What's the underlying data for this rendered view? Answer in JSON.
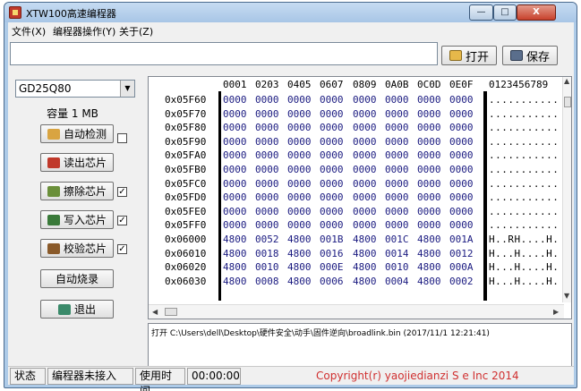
{
  "window": {
    "title": "XTW100高速编程器",
    "min_glyph": "—",
    "max_glyph": "□",
    "close_glyph": "X"
  },
  "menu": {
    "file": "文件(X)",
    "operate": "编程器操作(Y)",
    "about": "关于(Z)"
  },
  "toolbar": {
    "open_label": "打开",
    "save_label": "保存"
  },
  "left": {
    "chip": "GD25Q80",
    "capacity": "容量 1 MB",
    "auto_detect": "自动检测",
    "read_chip": "读出芯片",
    "erase_chip": "擦除芯片",
    "write_chip": "写入芯片",
    "verify_chip": "校验芯片",
    "auto_burn": "自动烧录",
    "exit": "退出",
    "check_mark": "✓"
  },
  "hex": {
    "columns": [
      "0001",
      "0203",
      "0405",
      "0607",
      "0809",
      "0A0B",
      "0C0D",
      "0E0F"
    ],
    "ascii_header": "0123456789",
    "rows": [
      {
        "addr": "0x05F60",
        "cells": [
          "0000",
          "0000",
          "0000",
          "0000",
          "0000",
          "0000",
          "0000",
          "0000"
        ],
        "ascii": "..........."
      },
      {
        "addr": "0x05F70",
        "cells": [
          "0000",
          "0000",
          "0000",
          "0000",
          "0000",
          "0000",
          "0000",
          "0000"
        ],
        "ascii": "..........."
      },
      {
        "addr": "0x05F80",
        "cells": [
          "0000",
          "0000",
          "0000",
          "0000",
          "0000",
          "0000",
          "0000",
          "0000"
        ],
        "ascii": "..........."
      },
      {
        "addr": "0x05F90",
        "cells": [
          "0000",
          "0000",
          "0000",
          "0000",
          "0000",
          "0000",
          "0000",
          "0000"
        ],
        "ascii": "..........."
      },
      {
        "addr": "0x05FA0",
        "cells": [
          "0000",
          "0000",
          "0000",
          "0000",
          "0000",
          "0000",
          "0000",
          "0000"
        ],
        "ascii": "..........."
      },
      {
        "addr": "0x05FB0",
        "cells": [
          "0000",
          "0000",
          "0000",
          "0000",
          "0000",
          "0000",
          "0000",
          "0000"
        ],
        "ascii": "..........."
      },
      {
        "addr": "0x05FC0",
        "cells": [
          "0000",
          "0000",
          "0000",
          "0000",
          "0000",
          "0000",
          "0000",
          "0000"
        ],
        "ascii": "..........."
      },
      {
        "addr": "0x05FD0",
        "cells": [
          "0000",
          "0000",
          "0000",
          "0000",
          "0000",
          "0000",
          "0000",
          "0000"
        ],
        "ascii": "..........."
      },
      {
        "addr": "0x05FE0",
        "cells": [
          "0000",
          "0000",
          "0000",
          "0000",
          "0000",
          "0000",
          "0000",
          "0000"
        ],
        "ascii": "..........."
      },
      {
        "addr": "0x05FF0",
        "cells": [
          "0000",
          "0000",
          "0000",
          "0000",
          "0000",
          "0000",
          "0000",
          "0000"
        ],
        "ascii": "..........."
      },
      {
        "addr": "0x06000",
        "cells": [
          "4800",
          "0052",
          "4800",
          "001B",
          "4800",
          "001C",
          "4800",
          "001A"
        ],
        "ascii": "H..RH....H."
      },
      {
        "addr": "0x06010",
        "cells": [
          "4800",
          "0018",
          "4800",
          "0016",
          "4800",
          "0014",
          "4800",
          "0012"
        ],
        "ascii": "H...H....H."
      },
      {
        "addr": "0x06020",
        "cells": [
          "4800",
          "0010",
          "4800",
          "000E",
          "4800",
          "0010",
          "4800",
          "000A"
        ],
        "ascii": "H...H....H."
      },
      {
        "addr": "0x06030",
        "cells": [
          "4800",
          "0008",
          "4800",
          "0006",
          "4800",
          "0004",
          "4800",
          "0002"
        ],
        "ascii": "H...H....H."
      }
    ]
  },
  "log": {
    "line": "打开 C:\\Users\\dell\\Desktop\\硬件安全\\动手\\固件逆向\\broadlink.bin (2017/11/1 12:21:41)"
  },
  "status": {
    "state_label": "状态",
    "connection": "编程器未接入",
    "time_label": "使用时间",
    "time_value": "00:00:00",
    "copyright": "Copyright(r) yaojiedianzi S    e Inc 2014"
  },
  "colors": {
    "accent": "#aecbe8",
    "hex_text": "#1a1a80",
    "copyright": "#d03030"
  }
}
